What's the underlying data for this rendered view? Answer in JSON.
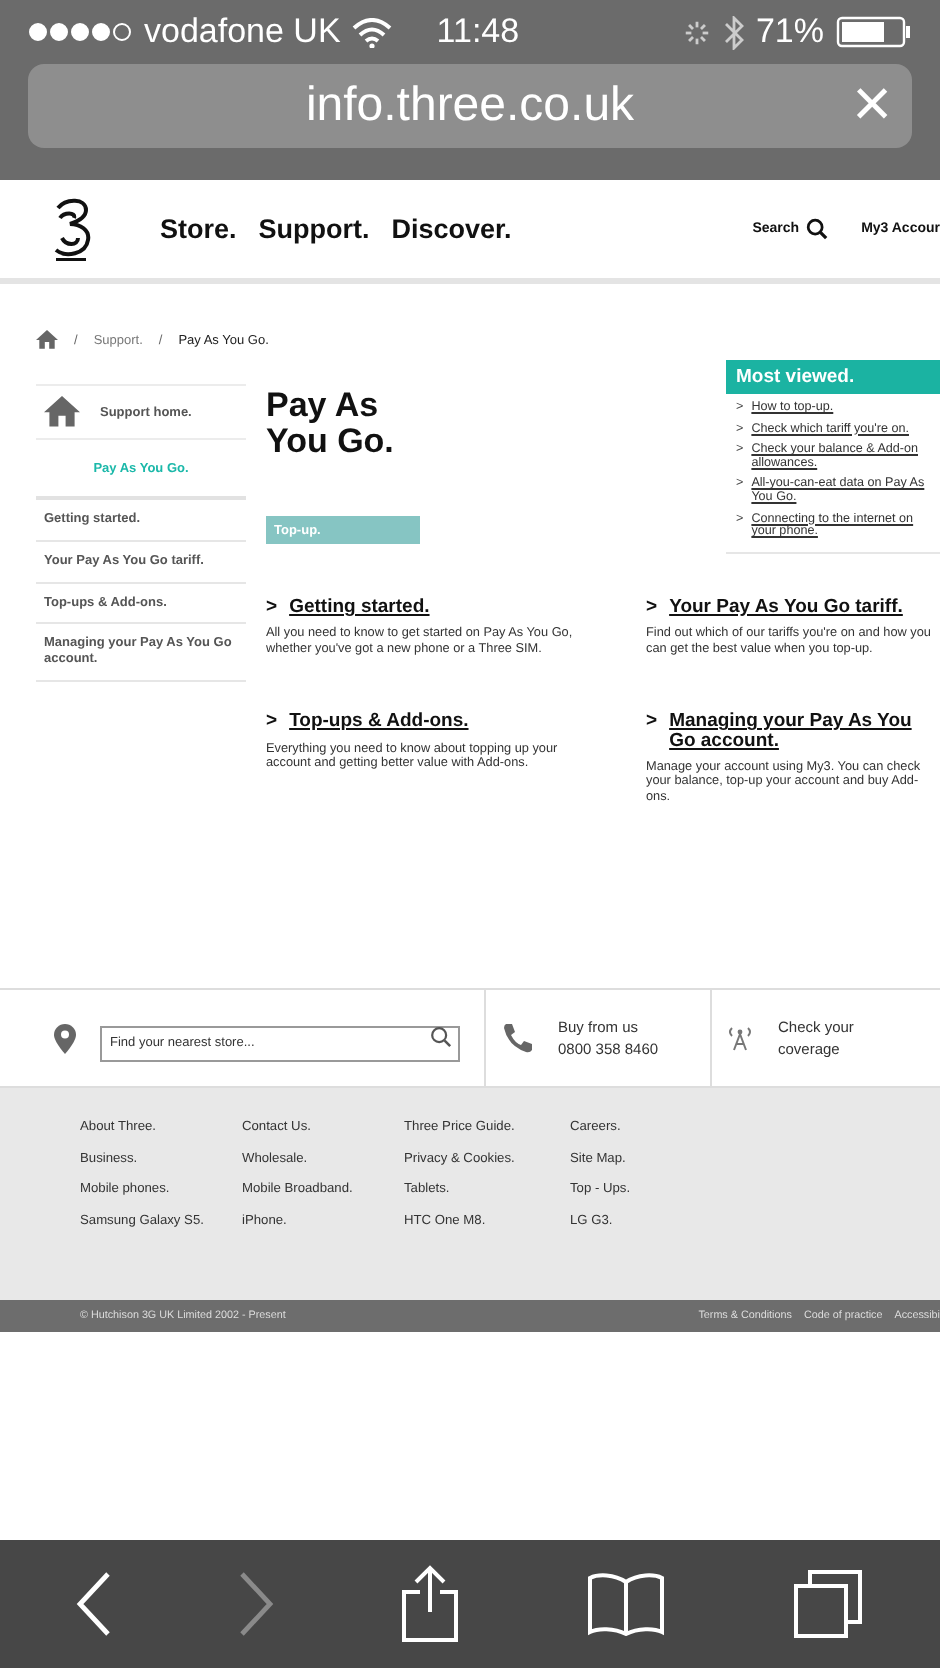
{
  "status_bar": {
    "carrier": "vodafone UK",
    "time": "11:48",
    "battery": "71%"
  },
  "address_bar": {
    "url": "info.three.co.uk",
    "clear": "×"
  },
  "header": {
    "nav": [
      "Store.",
      "Support.",
      "Discover."
    ],
    "search": "Search",
    "account": "My3 Accour"
  },
  "breadcrumb": {
    "separator": "/",
    "links": [
      "Support.",
      "Pay As You Go."
    ]
  },
  "sidebar": {
    "home": "Support home.",
    "section": {
      "label": "Pay As You Go.",
      "selected": true
    },
    "items": [
      {
        "label": "Getting started.",
        "selected": false
      },
      {
        "label": "Your Pay As You Go tariff.",
        "selected": false
      },
      {
        "label": "Top-ups & Add-ons.",
        "selected": false
      },
      {
        "label": "Managing your Pay As You Go account.",
        "selected": false
      }
    ]
  },
  "page_title": "Pay As You Go.",
  "top_up_button": "Top-up.",
  "most_viewed": {
    "title": "Most viewed.",
    "bullet": ">",
    "links": [
      "How to top-up.",
      "Check which tariff you're on.",
      "Check your balance & Add-on allowances.",
      "All-you-can-eat data on Pay As You Go.",
      "Connecting to the internet on your phone."
    ]
  },
  "topics": [
    {
      "bullet": ">",
      "title": "Getting started.",
      "text": "All you need to know to get started on Pay As You Go, whether you've got a new phone or a Three SIM."
    },
    {
      "bullet": ">",
      "title": "Your Pay As You Go tariff.",
      "text": "Find out which of our tariffs you're on and how you can get the best value when you top-up."
    },
    {
      "bullet": ">",
      "title": "Top-ups & Add-ons.",
      "text": "Everything you need to know about topping up your account and getting better value with Add-ons."
    },
    {
      "bullet": ">",
      "title": "Managing your Pay As You Go account.",
      "text": "Manage your account using My3. You can check your balance, top-up your account and buy Add-ons."
    }
  ],
  "store_strip": {
    "placeholder": "Find your nearest store...",
    "buy_label": "Buy from us",
    "phone": "0800 358 8460",
    "coverage": "Check your coverage"
  },
  "footer_links": [
    [
      "About Three.",
      "Business.",
      "Mobile phones.",
      "Samsung Galaxy S5."
    ],
    [
      "Contact Us.",
      "Wholesale.",
      "Mobile Broadband.",
      "iPhone."
    ],
    [
      "Three Price Guide.",
      "Privacy & Cookies.",
      "Tablets.",
      "HTC One M8."
    ],
    [
      "Careers.",
      "Site Map.",
      "Top - Ups.",
      "LG G3."
    ]
  ],
  "legal": {
    "copyright": "© Hutchison 3G UK Limited 2002 - Present",
    "links": [
      "Terms & Conditions",
      "Code of practice",
      "Accessibi"
    ]
  },
  "toolbar": [
    {
      "kind": "back",
      "disabled": false
    },
    {
      "kind": "forward",
      "disabled": true
    },
    {
      "kind": "share",
      "disabled": false
    },
    {
      "kind": "bookmarks",
      "disabled": false
    },
    {
      "kind": "tabs",
      "disabled": false
    }
  ]
}
